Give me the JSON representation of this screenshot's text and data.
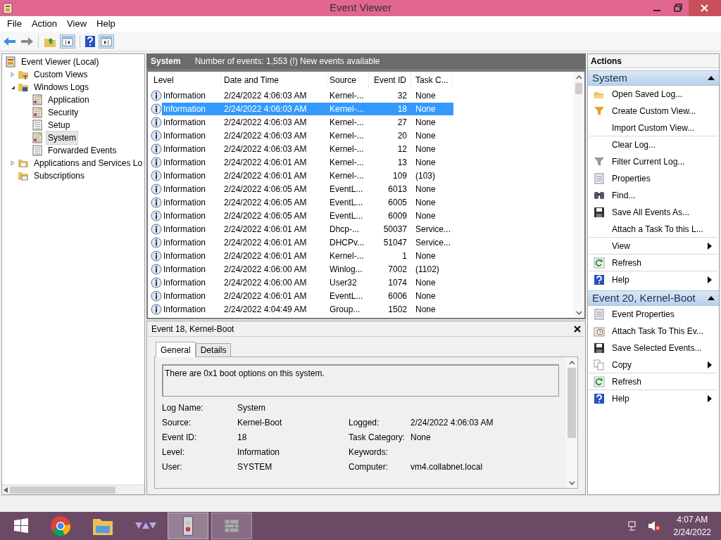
{
  "window": {
    "title": "Event Viewer"
  },
  "menu": [
    "File",
    "Action",
    "View",
    "Help"
  ],
  "tree": [
    {
      "label": "Event Viewer (Local)",
      "has_expander": false,
      "selected": false,
      "kind": "root",
      "children": [
        {
          "label": "Custom Views",
          "has_expander": true,
          "expanded": false,
          "selected": false,
          "kind": "filter-folder"
        },
        {
          "label": "Windows Logs",
          "has_expander": true,
          "expanded": true,
          "selected": false,
          "kind": "logs-folder",
          "children": [
            {
              "label": "Application",
              "has_expander": false,
              "selected": false,
              "kind": "log"
            },
            {
              "label": "Security",
              "has_expander": false,
              "selected": false,
              "kind": "log"
            },
            {
              "label": "Setup",
              "has_expander": false,
              "selected": false,
              "kind": "plain-log"
            },
            {
              "label": "System",
              "has_expander": false,
              "selected": true,
              "kind": "log"
            },
            {
              "label": "Forwarded Events",
              "has_expander": false,
              "selected": false,
              "kind": "plain-log"
            }
          ]
        },
        {
          "label": "Applications and Services Lo",
          "has_expander": true,
          "expanded": false,
          "selected": false,
          "kind": "folder"
        },
        {
          "label": "Subscriptions",
          "has_expander": false,
          "selected": false,
          "kind": "sub-folder"
        }
      ]
    }
  ],
  "event_list": {
    "title": "System",
    "summary": "Number of events: 1,553 (!) New events available",
    "columns": [
      "Level",
      "Date and Time",
      "Source",
      "Event ID",
      "Task C..."
    ],
    "rows": [
      {
        "level": "Information",
        "date": "2/24/2022 4:06:03 AM",
        "source": "Kernel-...",
        "event_id": "32",
        "task": "None",
        "selected": false
      },
      {
        "level": "Information",
        "date": "2/24/2022 4:06:03 AM",
        "source": "Kernel-...",
        "event_id": "18",
        "task": "None",
        "selected": true
      },
      {
        "level": "Information",
        "date": "2/24/2022 4:06:03 AM",
        "source": "Kernel-...",
        "event_id": "27",
        "task": "None",
        "selected": false
      },
      {
        "level": "Information",
        "date": "2/24/2022 4:06:03 AM",
        "source": "Kernel-...",
        "event_id": "20",
        "task": "None",
        "selected": false
      },
      {
        "level": "Information",
        "date": "2/24/2022 4:06:03 AM",
        "source": "Kernel-...",
        "event_id": "12",
        "task": "None",
        "selected": false
      },
      {
        "level": "Information",
        "date": "2/24/2022 4:06:01 AM",
        "source": "Kernel-...",
        "event_id": "13",
        "task": "None",
        "selected": false
      },
      {
        "level": "Information",
        "date": "2/24/2022 4:06:01 AM",
        "source": "Kernel-...",
        "event_id": "109",
        "task": "(103)",
        "selected": false
      },
      {
        "level": "Information",
        "date": "2/24/2022 4:06:05 AM",
        "source": "EventL...",
        "event_id": "6013",
        "task": "None",
        "selected": false
      },
      {
        "level": "Information",
        "date": "2/24/2022 4:06:05 AM",
        "source": "EventL...",
        "event_id": "6005",
        "task": "None",
        "selected": false
      },
      {
        "level": "Information",
        "date": "2/24/2022 4:06:05 AM",
        "source": "EventL...",
        "event_id": "6009",
        "task": "None",
        "selected": false
      },
      {
        "level": "Information",
        "date": "2/24/2022 4:06:01 AM",
        "source": "Dhcp-...",
        "event_id": "50037",
        "task": "Service...",
        "selected": false
      },
      {
        "level": "Information",
        "date": "2/24/2022 4:06:01 AM",
        "source": "DHCPv...",
        "event_id": "51047",
        "task": "Service...",
        "selected": false
      },
      {
        "level": "Information",
        "date": "2/24/2022 4:06:01 AM",
        "source": "Kernel-...",
        "event_id": "1",
        "task": "None",
        "selected": false
      },
      {
        "level": "Information",
        "date": "2/24/2022 4:06:00 AM",
        "source": "Winlog...",
        "event_id": "7002",
        "task": "(1102)",
        "selected": false
      },
      {
        "level": "Information",
        "date": "2/24/2022 4:06:00 AM",
        "source": "User32",
        "event_id": "1074",
        "task": "None",
        "selected": false
      },
      {
        "level": "Information",
        "date": "2/24/2022 4:06:01 AM",
        "source": "EventL...",
        "event_id": "6006",
        "task": "None",
        "selected": false
      },
      {
        "level": "Information",
        "date": "2/24/2022 4:04:49 AM",
        "source": "Group...",
        "event_id": "1502",
        "task": "None",
        "selected": false
      }
    ]
  },
  "details": {
    "title": "Event 18, Kernel-Boot",
    "tabs": [
      {
        "label": "General",
        "selected": true
      },
      {
        "label": "Details",
        "selected": false
      }
    ],
    "message": "There are 0x1 boot options on this system.",
    "fields": [
      {
        "label": "Log Name:",
        "value": "System"
      },
      {
        "label": "Source:",
        "value": "Kernel-Boot",
        "label2": "Logged:",
        "value2": "2/24/2022 4:06:03 AM"
      },
      {
        "label": "Event ID:",
        "value": "18",
        "label2": "Task Category:",
        "value2": "None"
      },
      {
        "label": "Level:",
        "value": "Information",
        "label2": "Keywords:"
      },
      {
        "label": "User:",
        "value": "SYSTEM",
        "label2": "Computer:",
        "value2": "vm4.collabnet.local"
      }
    ]
  },
  "actions": {
    "title": "Actions",
    "sections": [
      {
        "title": "System",
        "items": [
          {
            "label": "Open Saved Log...",
            "kind": "open",
            "submenu": false,
            "divider_after": false
          },
          {
            "label": "Create Custom View...",
            "kind": "funnel",
            "submenu": false,
            "divider_after": false
          },
          {
            "label": "Import Custom View...",
            "kind": "none",
            "submenu": false,
            "divider_after": true
          },
          {
            "label": "Clear Log...",
            "kind": "none",
            "submenu": false,
            "divider_after": false
          },
          {
            "label": "Filter Current Log...",
            "kind": "filter",
            "submenu": false,
            "divider_after": false
          },
          {
            "label": "Properties",
            "kind": "properties",
            "submenu": false,
            "divider_after": false
          },
          {
            "label": "Find...",
            "kind": "find",
            "submenu": false,
            "divider_after": false
          },
          {
            "label": "Save All Events As...",
            "kind": "save",
            "submenu": false,
            "divider_after": false
          },
          {
            "label": "Attach a Task To this L...",
            "kind": "none",
            "submenu": false,
            "divider_after": true
          },
          {
            "label": "View",
            "kind": "none",
            "submenu": true,
            "divider_after": true
          },
          {
            "label": "Refresh",
            "kind": "refresh",
            "submenu": false,
            "divider_after": true
          },
          {
            "label": "Help",
            "kind": "help",
            "submenu": true,
            "divider_after": false
          }
        ]
      },
      {
        "title": "Event 20, Kernel-Boot",
        "items": [
          {
            "label": "Event Properties",
            "kind": "properties",
            "submenu": false,
            "divider_after": false
          },
          {
            "label": "Attach Task To This Ev...",
            "kind": "task",
            "submenu": false,
            "divider_after": false
          },
          {
            "label": "Save Selected Events...",
            "kind": "save",
            "submenu": false,
            "divider_after": false
          },
          {
            "label": "Copy",
            "kind": "copy",
            "submenu": true,
            "divider_after": true
          },
          {
            "label": "Refresh",
            "kind": "refresh",
            "submenu": false,
            "divider_after": true
          },
          {
            "label": "Help",
            "kind": "help",
            "submenu": true,
            "divider_after": false
          }
        ]
      }
    ]
  },
  "taskbar": {
    "time": "4:07 AM",
    "date": "2/24/2022"
  }
}
